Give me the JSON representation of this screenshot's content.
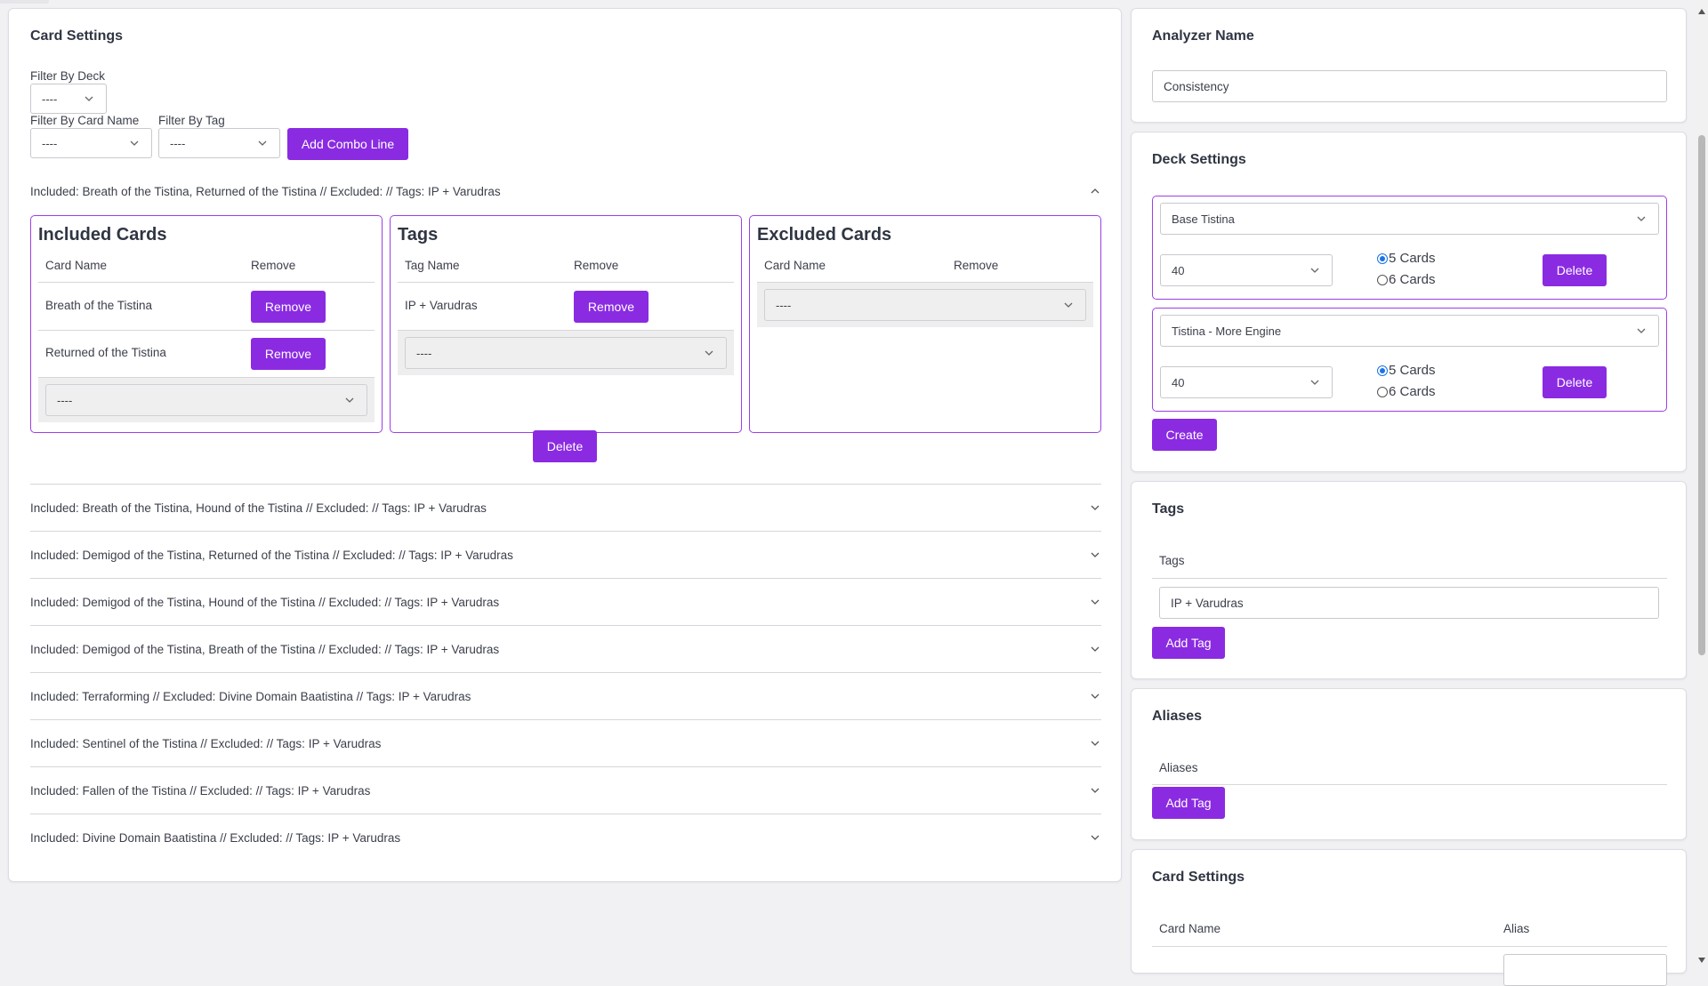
{
  "card_settings": {
    "title": "Card Settings",
    "filter_deck_label": "Filter By Deck",
    "filter_deck_value": "----",
    "filter_card_label": "Filter By Card Name",
    "filter_card_value": "----",
    "filter_tag_label": "Filter By Tag",
    "filter_tag_value": "----",
    "add_combo_label": "Add Combo Line",
    "expanded": {
      "header": "Included: Breath of the Tistina, Returned of the Tistina // Excluded: // Tags: IP + Varudras",
      "included": {
        "title": "Included Cards",
        "col_name": "Card Name",
        "col_remove": "Remove",
        "rows": [
          {
            "name": "Breath of the Tistina",
            "button": "Remove"
          },
          {
            "name": "Returned of the Tistina",
            "button": "Remove"
          }
        ],
        "select_value": "----"
      },
      "tags": {
        "title": "Tags",
        "col_name": "Tag Name",
        "col_remove": "Remove",
        "rows": [
          {
            "name": "IP + Varudras",
            "button": "Remove"
          }
        ],
        "select_value": "----"
      },
      "excluded": {
        "title": "Excluded Cards",
        "col_name": "Card Name",
        "col_remove": "Remove",
        "select_value": "----"
      },
      "delete_label": "Delete"
    },
    "combo_lines": [
      "Included: Breath of the Tistina, Hound of the Tistina // Excluded: // Tags: IP + Varudras",
      "Included: Demigod of the Tistina, Returned of the Tistina // Excluded: // Tags: IP + Varudras",
      "Included: Demigod of the Tistina, Hound of the Tistina // Excluded: // Tags: IP + Varudras",
      "Included: Demigod of the Tistina, Breath of the Tistina // Excluded: // Tags: IP + Varudras",
      "Included: Terraforming // Excluded: Divine Domain Baatistina // Tags: IP + Varudras",
      "Included: Sentinel of the Tistina // Excluded: // Tags: IP + Varudras",
      "Included: Fallen of the Tistina // Excluded: // Tags: IP + Varudras",
      "Included: Divine Domain Baatistina // Excluded: // Tags: IP + Varudras"
    ]
  },
  "analyzer": {
    "title": "Analyzer Name",
    "value": "Consistency"
  },
  "deck_settings": {
    "title": "Deck Settings",
    "decks": [
      {
        "name": "Base Tistina",
        "size": "40",
        "opt1": "5 Cards",
        "opt2": "6 Cards",
        "delete": "Delete"
      },
      {
        "name": "Tistina - More Engine",
        "size": "40",
        "opt1": "5 Cards",
        "opt2": "6 Cards",
        "delete": "Delete"
      }
    ],
    "create_label": "Create"
  },
  "tags_panel": {
    "title": "Tags",
    "column": "Tags",
    "value": "IP + Varudras",
    "add_label": "Add Tag"
  },
  "aliases_panel": {
    "title": "Aliases",
    "column": "Aliases",
    "add_label": "Add Tag"
  },
  "card_settings_right": {
    "title": "Card Settings",
    "col_name": "Card Name",
    "col_alias": "Alias"
  },
  "colors": {
    "accent": "#8a2be2",
    "border_accent": "#9b3fe6",
    "radio_selected": "#1a73e8"
  }
}
